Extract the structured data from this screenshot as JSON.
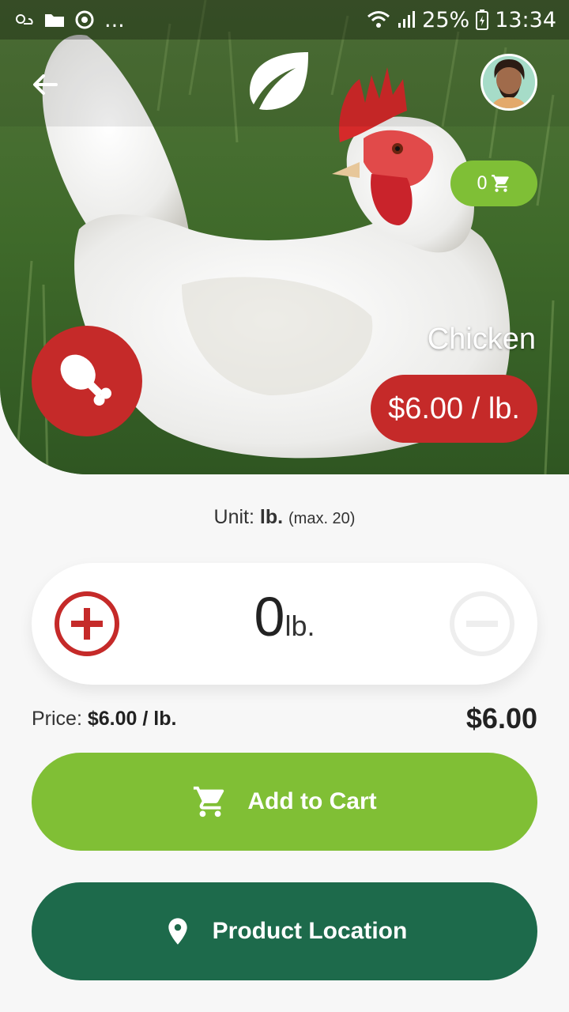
{
  "status_bar": {
    "dots": "...",
    "battery": "25%",
    "time": "13:34"
  },
  "header": {
    "back_icon": "arrow-left-icon",
    "logo_icon": "leaf-icon",
    "cart_count": "0"
  },
  "product": {
    "name": "Chicken",
    "price_pill": "$6.00 / lb.",
    "category_icon": "drumstick-icon"
  },
  "unit_row": {
    "label": "Unit:",
    "unit": "lb.",
    "max": "(max. 20)"
  },
  "quantity": {
    "value": "0",
    "unit": "lb."
  },
  "price_row": {
    "label": "Price:",
    "value": "$6.00 / lb.",
    "total": "$6.00"
  },
  "buttons": {
    "add_to_cart": "Add to Cart",
    "product_location": "Product Location"
  },
  "colors": {
    "red": "#c52a29",
    "lime": "#80bf35",
    "forest": "#1d6a4b"
  }
}
